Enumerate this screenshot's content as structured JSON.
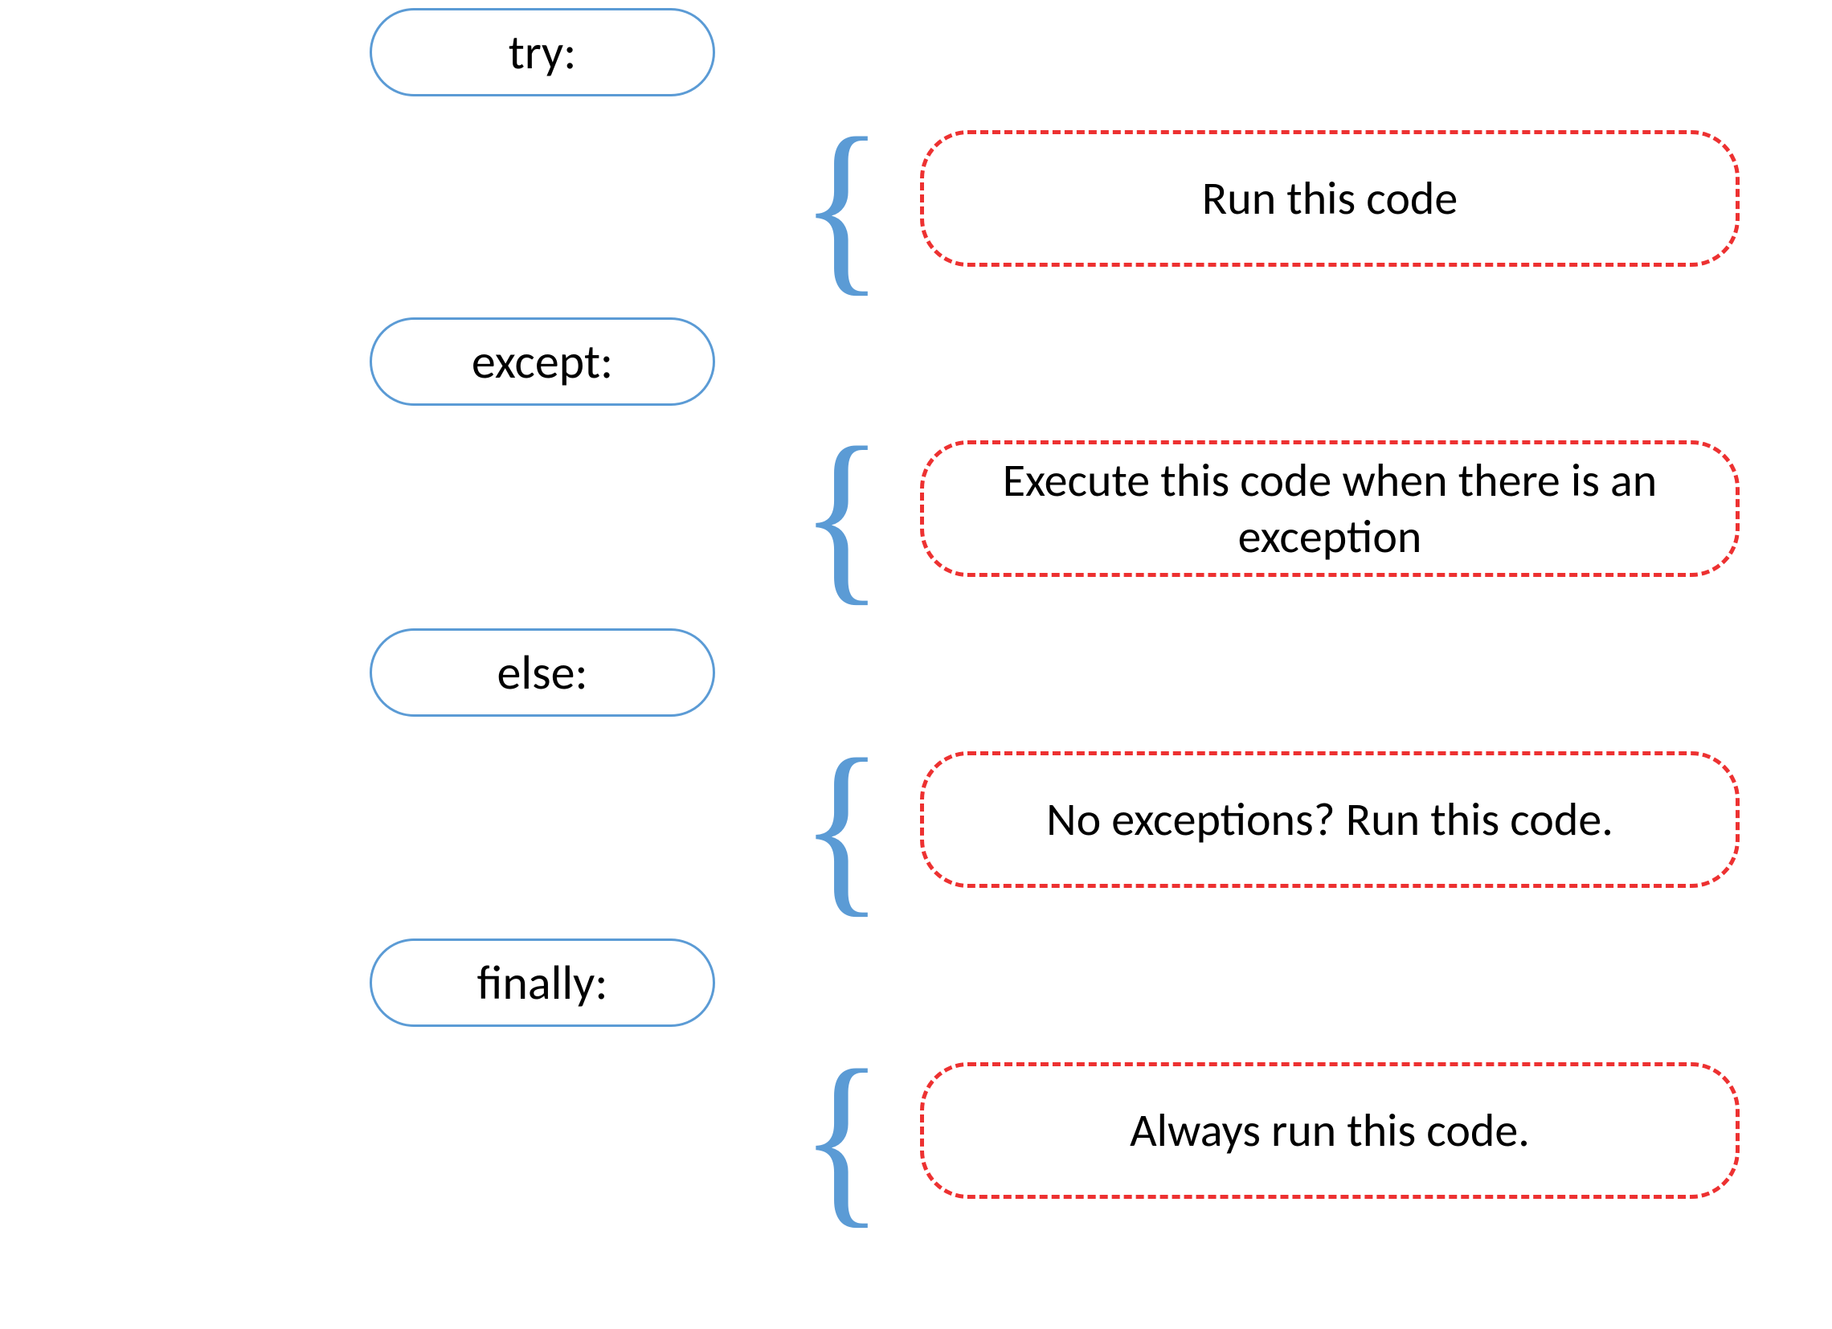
{
  "blocks": [
    {
      "keyword": "try:",
      "description": "Run this code"
    },
    {
      "keyword": "except:",
      "description": "Execute this code when there is an exception"
    },
    {
      "keyword": "else:",
      "description": "No exceptions? Run this code."
    },
    {
      "keyword": "finally:",
      "description": "Always run this code."
    }
  ],
  "brace_glyph": "{",
  "colors": {
    "keyword_border": "#5b9bd5",
    "description_border": "#ed3131",
    "brace": "#5b9bd5"
  }
}
